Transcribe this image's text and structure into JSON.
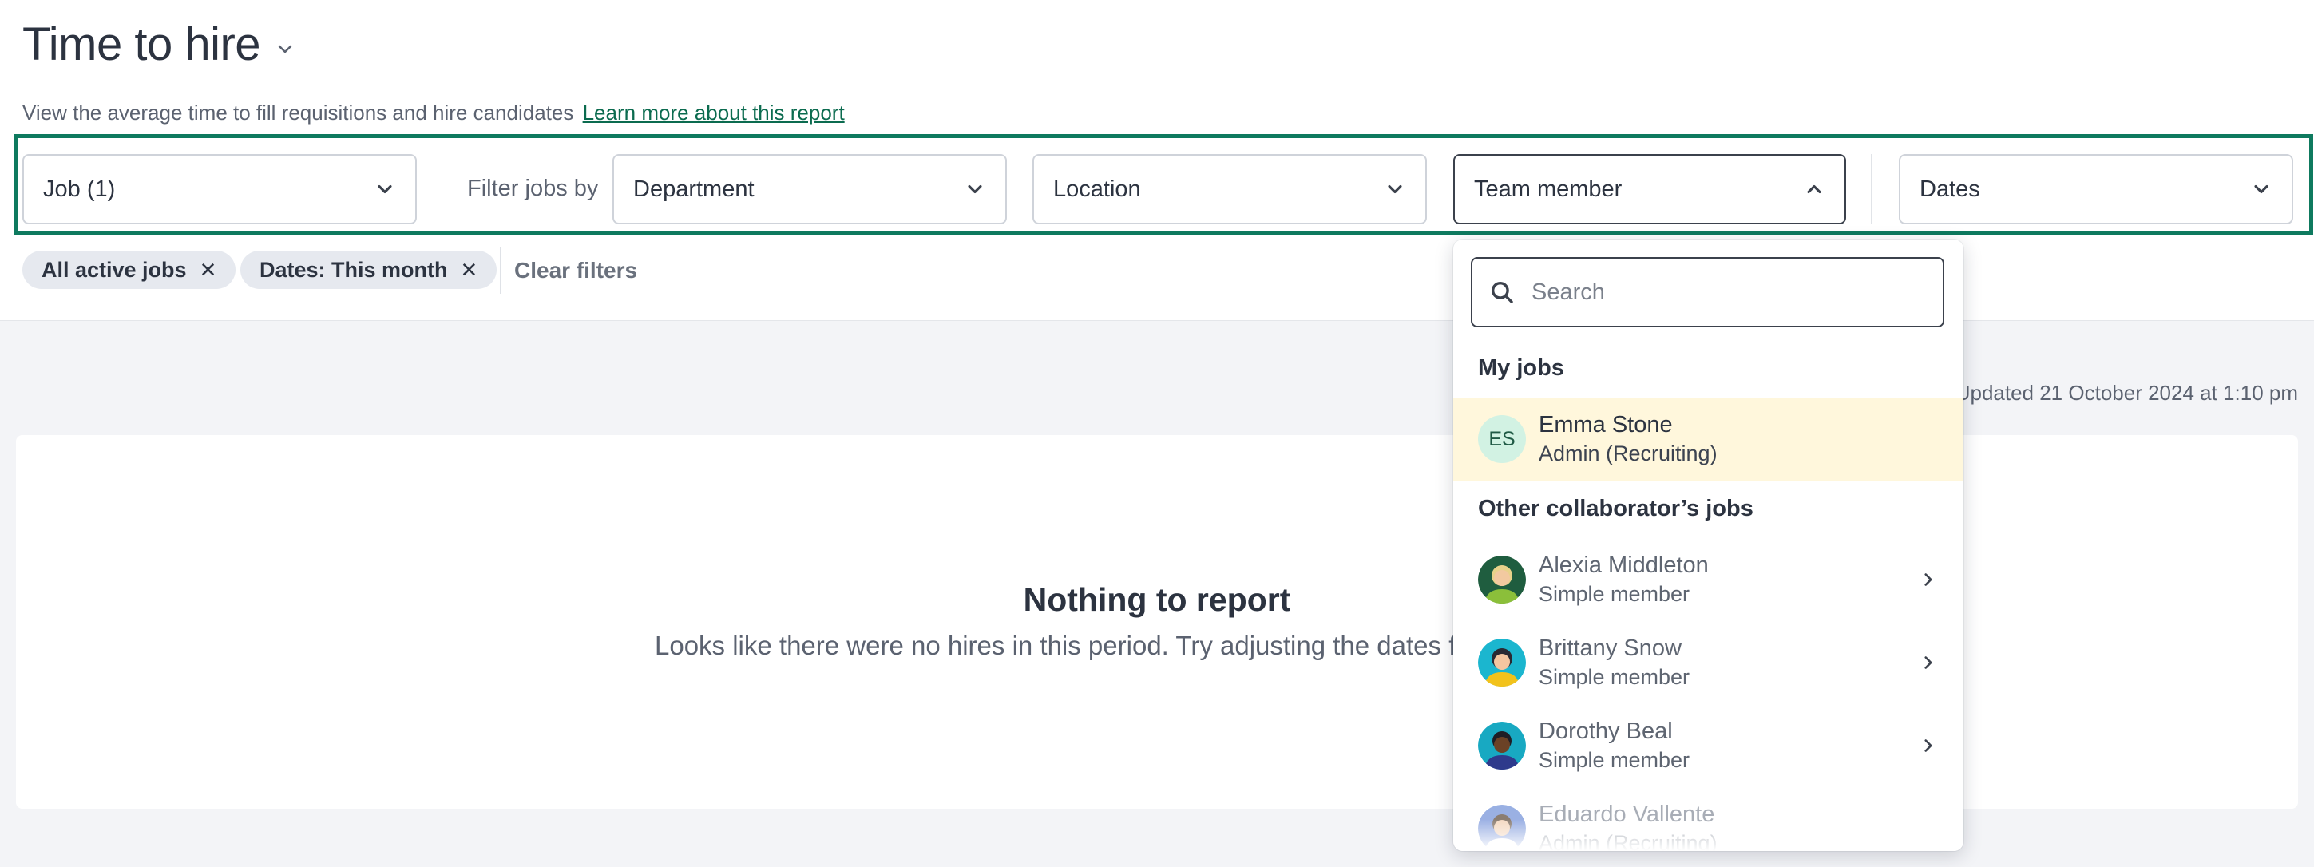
{
  "header": {
    "title": "Time to hire",
    "subtitle": "View the average time to fill requisitions and hire candidates",
    "learn_more": "Learn more about this report"
  },
  "filters": {
    "job": "Job (1)",
    "filter_label": "Filter jobs by",
    "department": "Department",
    "location": "Location",
    "team_member": "Team member",
    "dates": "Dates"
  },
  "active_filters": {
    "chips": [
      "All active jobs",
      "Dates: This month"
    ],
    "clear": "Clear filters"
  },
  "report": {
    "updated": "Updated 21 October 2024 at 1:10 pm",
    "empty_title": "Nothing to report",
    "empty_subtitle": "Looks like there were no hires in this period. Try adjusting the dates fo"
  },
  "dropdown": {
    "search_placeholder": "Search",
    "my_jobs_heading": "My jobs",
    "my_jobs": [
      {
        "initials": "ES",
        "name": "Emma Stone",
        "role": "Admin (Recruiting)"
      }
    ],
    "other_heading": "Other collaborator’s jobs",
    "others": [
      {
        "name": "Alexia Middleton",
        "role": "Simple member",
        "avatar_bg": "#1f5d3f",
        "face": "#f2c9a0",
        "hair": "#e8d28a",
        "shirt": "#8bbf3a"
      },
      {
        "name": "Brittany Snow",
        "role": "Simple member",
        "avatar_bg": "#1bb6cf",
        "face": "#f5c6a0",
        "hair": "#2a2a33",
        "shirt": "#f2c21b"
      },
      {
        "name": "Dorothy Beal",
        "role": "Simple member",
        "avatar_bg": "#18a9c2",
        "face": "#6b4226",
        "hair": "#1e1e26",
        "shirt": "#2e3a8c"
      },
      {
        "name": "Eduardo Vallente",
        "role": "Admin (Recruiting)",
        "avatar_bg": "#6f8fd8",
        "face": "#f0c9a8",
        "hair": "#5a4636",
        "shirt": "#ffffff"
      }
    ]
  },
  "colors": {
    "accent": "#0e7a5f",
    "highlight_row": "#fff7dc"
  }
}
